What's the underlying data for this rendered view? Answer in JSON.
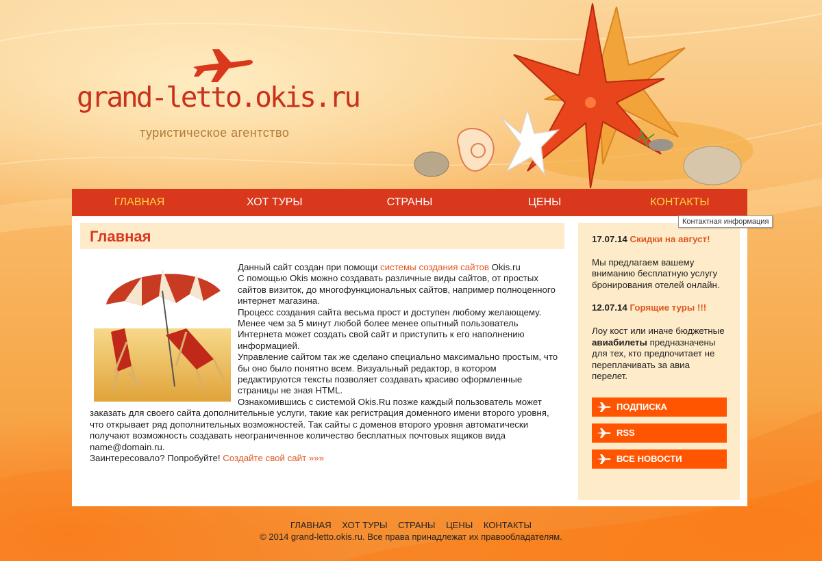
{
  "header": {
    "site_title": "grand-letto.okis.ru",
    "tagline": "туристическое агентство"
  },
  "nav": {
    "items": [
      {
        "label": "Главная",
        "state": "active"
      },
      {
        "label": "Хот туры",
        "state": "normal"
      },
      {
        "label": "Страны",
        "state": "normal"
      },
      {
        "label": "Цены",
        "state": "normal"
      },
      {
        "label": "Контакты",
        "state": "hover"
      }
    ],
    "tooltip": "Контактная информация"
  },
  "main": {
    "heading": "Главная",
    "p1_before": "Данный сайт создан при помощи ",
    "p1_link": "системы создания сайтов",
    "p1_after": " Okis.ru",
    "p2": "С помощью Okis можно создавать различные виды сайтов, от простых сайтов визиток, до многофункциональных сайтов, например полноценного интернет магазина.",
    "p3": "Процесс создания сайта весьма прост и доступен любому желающему. Менее чем за 5 минут любой более менее опытный пользователь Интернета может создать свой сайт и приступить к его наполнению информацией.",
    "p4": "Управление сайтом так же сделано специально максимально простым, что бы оно было понятно всем. Визуальный редактор, в котором редактируются тексты позволяет создавать красиво оформленные страницы не зная HTML.",
    "p5": "Ознакомившись с системой Okis.Ru позже каждый пользователь может заказать для своего сайта дополнительные услуги, такие как регистрация доменного имени второго уровня, что открывает ряд дополнительных возможностей. Так сайты с доменов второго уровня автоматически получают возможность создавать неограниченное количество бесплатных почтовых ящиков вида name@domain.ru.",
    "p6_before": "Заинтересовало? Попробуйте! ",
    "p6_link": "Создайте свой сайт »»»"
  },
  "sidebar": {
    "news": [
      {
        "date": "17.07.14",
        "title": "Скидки на август!",
        "text_before": "Мы предлагаем вашему вниманию бесплатную услугу бронирования отелей онлайн.",
        "text_bold": "",
        "text_after": ""
      },
      {
        "date": "12.07.14",
        "title": "Горящие туры !!!",
        "text_before": "Лоу кост или иначе бюджетные ",
        "text_bold": "авиабилеты",
        "text_after": " предназначены для тех, кто предпочитает не переплачивать за авиа перелет."
      }
    ],
    "buttons": [
      "ПОДПИСКА",
      "RSS",
      "ВСЕ НОВОСТИ"
    ]
  },
  "footer": {
    "nav": [
      "Главная",
      "Хот туры",
      "Страны",
      "Цены",
      "Контакты"
    ],
    "copyright": "© 2014 grand-letto.okis.ru. Все права принадлежат их правообладателям."
  },
  "colors": {
    "nav_bg": "#d9381c",
    "accent": "#e0561e",
    "button": "#ff5500",
    "panel": "#fdebc9",
    "nav_active": "#ffd23f"
  },
  "icons": [
    "airplane-logo-icon",
    "airplane-icon"
  ]
}
